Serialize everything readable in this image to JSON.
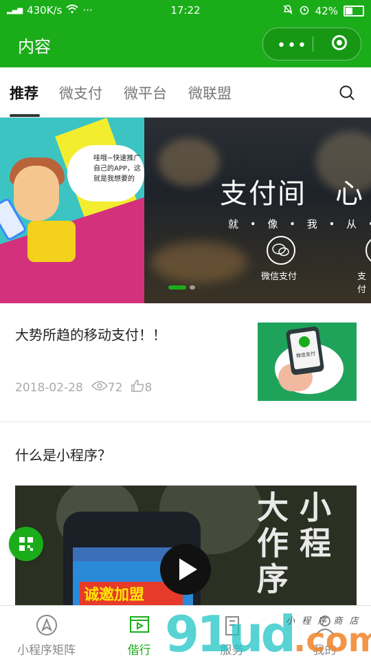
{
  "status_bar": {
    "carrier_signal": "4G",
    "speed": "430K/s",
    "more": "···",
    "time": "17:22",
    "battery": "42%",
    "battery_level": 0.42
  },
  "nav": {
    "title": "内容",
    "more_label": "•••"
  },
  "tabs": [
    {
      "label": "推荐",
      "active": true
    },
    {
      "label": "微支付",
      "active": false
    },
    {
      "label": "微平台",
      "active": false
    },
    {
      "label": "微联盟",
      "active": false
    }
  ],
  "banner": {
    "slide1_bubble": "哇哦~快速推广自己的APP，这就是我想要的",
    "slide2_headline": "支付间　心",
    "slide2_subline": "就 • 像 • 我 • 从 •",
    "slide2_icon_label": "微信支付",
    "slide2_icon_label_2": "支付"
  },
  "articles": [
    {
      "title": "大势所趋的移动支付！！",
      "date": "2018-02-28",
      "views": "72",
      "likes": "8",
      "thumb_label": "微信支付"
    },
    {
      "title": "什么是小程序？",
      "video_promo": "诚邀加盟",
      "video_text": "大 小 作 程 序"
    }
  ],
  "tabbar": [
    {
      "label": "小程序矩阵",
      "icon": "compass-icon",
      "active": false
    },
    {
      "label": "偕行",
      "icon": "video-icon",
      "active": true
    },
    {
      "label": "服务",
      "icon": "building-icon",
      "active": false
    },
    {
      "label": "我的",
      "icon": "user-icon",
      "active": false
    }
  ],
  "watermark": {
    "text": "91ud",
    "suffix": ".com",
    "small": "小 程 序 商 店"
  },
  "colors": {
    "brand_green": "#1aad19"
  }
}
